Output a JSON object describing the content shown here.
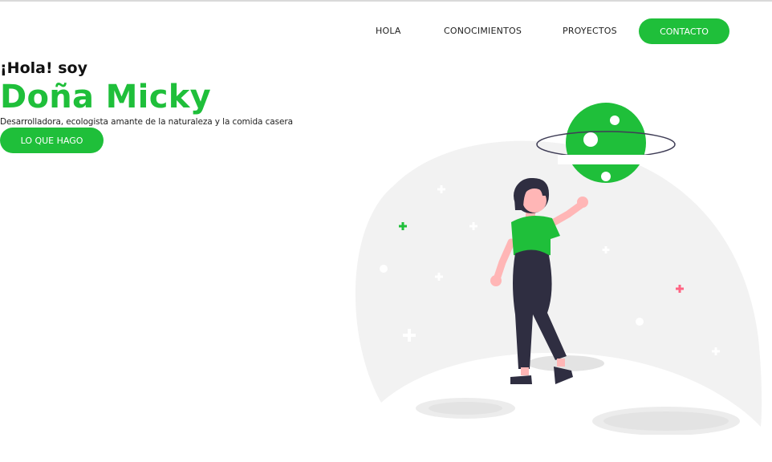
{
  "nav": {
    "items": [
      {
        "label": "HOLA"
      },
      {
        "label": "CONOCIMIENTOS"
      },
      {
        "label": "PROYECTOS"
      }
    ],
    "contact_label": "CONTACTO"
  },
  "hero": {
    "greeting": "¡Hola! soy",
    "name": "Doña Micky",
    "tagline": "Desarrolladora, ecologista amante de la naturaleza y la comida casera",
    "cta_label": "LO QUE HAGO"
  },
  "colors": {
    "accent": "#1fbf3a",
    "text": "#111111",
    "planet_bg": "#f2f2f2",
    "skin": "#ffb6b6",
    "pants": "#2f2e41",
    "star_pink": "#ff6584"
  },
  "illustration": {
    "icon": "astronaut-girl-planet-illustration"
  }
}
